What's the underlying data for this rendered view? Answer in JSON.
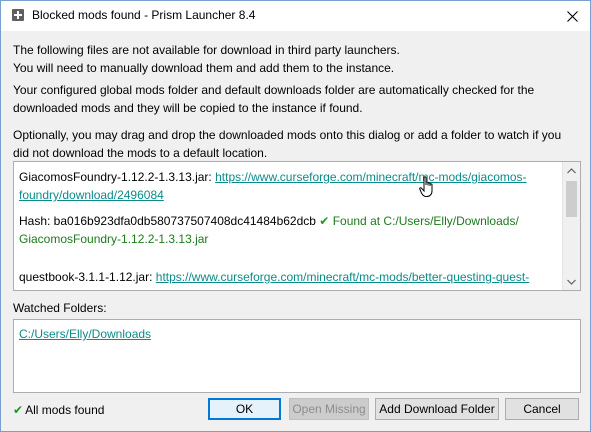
{
  "window": {
    "title": "Blocked mods found - Prism Launcher 8.4"
  },
  "messages": {
    "line1": "The following files are not available for download in third party launchers.",
    "line2": "You will need to manually download them and add them to the instance.",
    "line3": "Your configured global mods folder and default downloads folder are automatically checked for the",
    "line4": "downloaded mods and they will be copied to the instance if found.",
    "line5": "Optionally, you may drag and drop the downloaded mods onto this dialog or add a folder to watch if you",
    "line6": "did not download the mods to a default location."
  },
  "mods": [
    {
      "filename": "GiacomosFoundry-1.12.2-1.3.13.jar:",
      "url_line1": "https://www.curseforge.com/minecraft/mc-mods/giacomos-",
      "url_line2": "foundry/download/2496084",
      "hash_label": "Hash: ba016b923dfa0db580737507408dc41484b62dcb",
      "found_text": "Found at C:/Users/Elly/Downloads/",
      "found_path": "GiacomosFoundry-1.12.2-1.3.13.jar"
    },
    {
      "filename": "questbook-3.1.1-1.12.jar:",
      "url_line1": "https://www.curseforge.com/minecraft/mc-mods/better-questing-quest-"
    }
  ],
  "watched": {
    "label": "Watched Folders:",
    "folders": [
      "C:/Users/Elly/Downloads"
    ]
  },
  "status": {
    "text": "All mods found"
  },
  "buttons": {
    "ok": "OK",
    "open_missing": "Open Missing",
    "add_download_folder": "Add Download Folder",
    "cancel": "Cancel"
  },
  "colors": {
    "link": "#0a8c8c",
    "found": "#1d7a1d",
    "accent": "#0078d7"
  }
}
